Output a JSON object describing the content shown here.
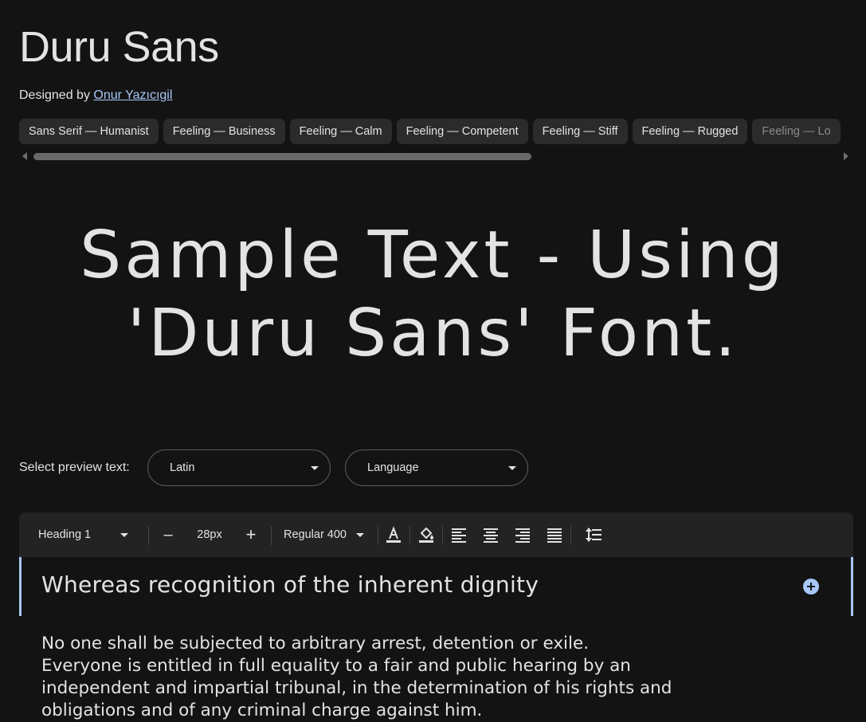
{
  "header": {
    "title": "Duru Sans",
    "designed_by_prefix": "Designed by",
    "designer_name": "Onur Yazıcıgil"
  },
  "tags": [
    "Sans Serif — Humanist",
    "Feeling — Business",
    "Feeling — Calm",
    "Feeling — Competent",
    "Feeling — Stiff",
    "Feeling — Rugged",
    "Feeling — Lo"
  ],
  "sample": {
    "line1": "Sample Text - Using",
    "line2": "'Duru Sans' Font."
  },
  "preview": {
    "label": "Select preview text:",
    "script_select": "Latin",
    "language_select": "Language"
  },
  "toolbar": {
    "style_select": "Heading 1",
    "decrease": "–",
    "size": "28px",
    "increase": "+",
    "weight_select": "Regular 400",
    "icons": [
      "text-color-icon",
      "highlight-color-icon",
      "align-left-icon",
      "align-center-icon",
      "align-right-icon",
      "align-justify-icon",
      "line-height-icon"
    ]
  },
  "editor": {
    "heading": "Whereas recognition of the inherent dignity",
    "paragraph_lines": [
      "No one shall be subjected to arbitrary arrest, detention or exile.",
      "Everyone is entitled in full equality to a fair and public hearing by an",
      "independent and impartial tribunal, in the determination of his rights and",
      "obligations and of any criminal charge against him."
    ]
  },
  "colors": {
    "background": "#131313",
    "accent": "#a8c7fa",
    "chip": "#2b2b2b",
    "toolbar": "#232323"
  }
}
